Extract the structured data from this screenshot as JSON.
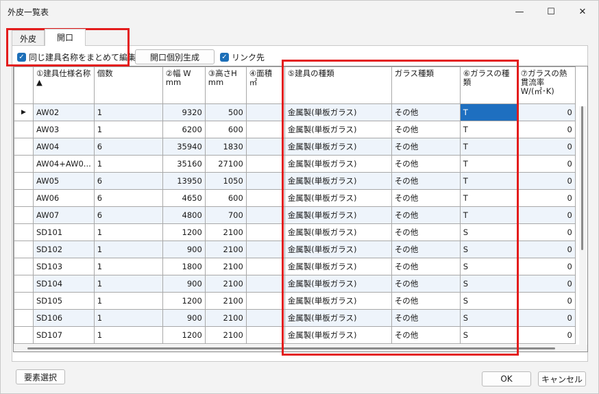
{
  "window": {
    "title": "外皮一覧表",
    "minimize": "—",
    "maximize": "☐",
    "close": "✕"
  },
  "tabs": [
    "外皮",
    "開口"
  ],
  "toolbar": {
    "group_same_name": "同じ建具名称をまとめて編集",
    "generate_button": "開口個別生成",
    "link_dest": "リンク先"
  },
  "table": {
    "headers": [
      "①建具仕様名称 ▲",
      "個数",
      "②幅 W mm",
      "③高さH mm",
      "④面積 ㎡",
      "⑤建具の種類",
      "ガラス種類",
      "⑥ガラスの種類",
      "⑦ガラスの熱貫流率 W/(㎡･K)"
    ],
    "rows": [
      [
        "AW02",
        "1",
        "9320",
        "500",
        "",
        "金属製(単板ガラス)",
        "その他",
        "T",
        "0"
      ],
      [
        "AW03",
        "1",
        "6200",
        "600",
        "",
        "金属製(単板ガラス)",
        "その他",
        "T",
        "0"
      ],
      [
        "AW04",
        "6",
        "35940",
        "1830",
        "",
        "金属製(単板ガラス)",
        "その他",
        "T",
        "0"
      ],
      [
        "AW04+AW0...",
        "1",
        "35160",
        "27100",
        "",
        "金属製(単板ガラス)",
        "その他",
        "T",
        "0"
      ],
      [
        "AW05",
        "6",
        "13950",
        "1050",
        "",
        "金属製(単板ガラス)",
        "その他",
        "T",
        "0"
      ],
      [
        "AW06",
        "6",
        "4650",
        "600",
        "",
        "金属製(単板ガラス)",
        "その他",
        "T",
        "0"
      ],
      [
        "AW07",
        "6",
        "4800",
        "700",
        "",
        "金属製(単板ガラス)",
        "その他",
        "T",
        "0"
      ],
      [
        "SD101",
        "1",
        "1200",
        "2100",
        "",
        "金属製(単板ガラス)",
        "その他",
        "S",
        "0"
      ],
      [
        "SD102",
        "1",
        "900",
        "2100",
        "",
        "金属製(単板ガラス)",
        "その他",
        "S",
        "0"
      ],
      [
        "SD103",
        "1",
        "1800",
        "2100",
        "",
        "金属製(単板ガラス)",
        "その他",
        "S",
        "0"
      ],
      [
        "SD104",
        "1",
        "900",
        "2100",
        "",
        "金属製(単板ガラス)",
        "その他",
        "S",
        "0"
      ],
      [
        "SD105",
        "1",
        "1200",
        "2100",
        "",
        "金属製(単板ガラス)",
        "その他",
        "S",
        "0"
      ],
      [
        "SD106",
        "1",
        "900",
        "2100",
        "",
        "金属製(単板ガラス)",
        "その他",
        "S",
        "0"
      ],
      [
        "SD107",
        "1",
        "1200",
        "2100",
        "",
        "金属製(単板ガラス)",
        "その他",
        "S",
        "0"
      ]
    ]
  },
  "footer": {
    "select_elements": "要素選択",
    "ok": "OK",
    "cancel": "キャンセル"
  },
  "colors": {
    "accent": "#1e6fc0",
    "highlight": "#e31b1b",
    "alt_row": "#eef4fb"
  }
}
